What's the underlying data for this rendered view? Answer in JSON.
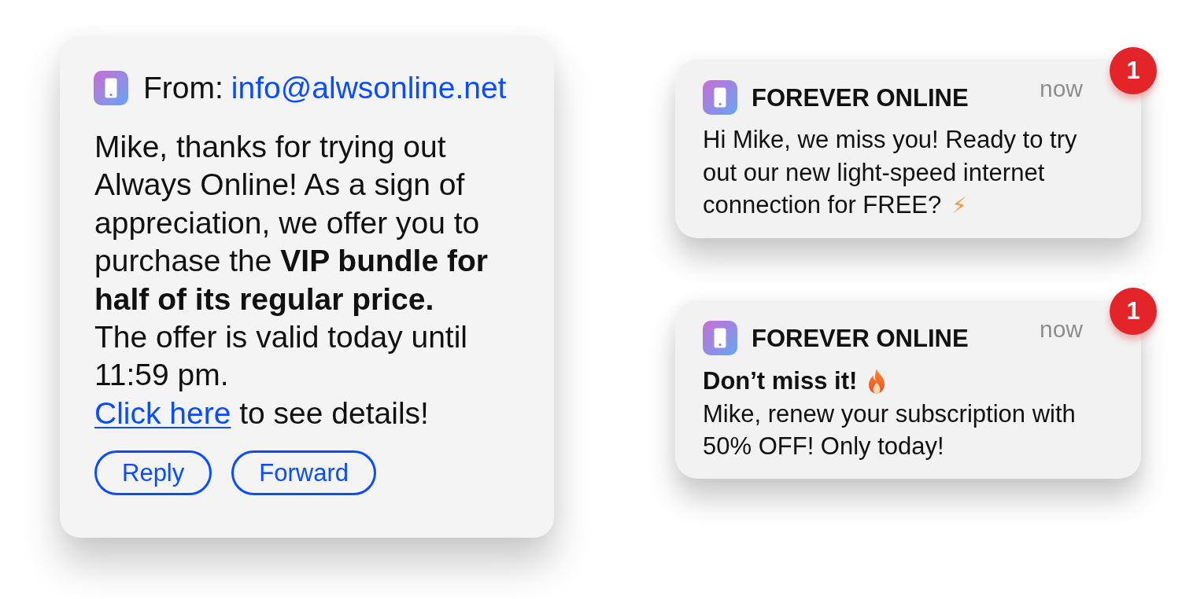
{
  "email": {
    "from_label": "From:",
    "from_address": "info@alwsonline.net",
    "paragraphs": [
      "Mike, thanks for trying out Always Online! As a sign of appreciation, we offer you to purchase the **VIP bundle for half of its regular price.**",
      "The offer is valid today until 11:59 pm."
    ],
    "details": {
      "link": "Click here",
      "text": "to see details!"
    },
    "buttons": [
      "Reply",
      "Forward"
    ]
  },
  "notifications": [
    {
      "kind": "plain",
      "app": "FOREVER ONLINE",
      "time": "now",
      "badge": "1",
      "body": "Hi Mike, we miss you! Ready to try out our new light-speed internet connection for FREE?",
      "emoji": "⚡"
    },
    {
      "kind": "headline",
      "app": "FOREVER ONLINE",
      "time": "now",
      "badge": "1",
      "headline": "Don’t miss it!",
      "body": "Mike, renew your subscription with 50% OFF! Only today!"
    }
  ]
}
